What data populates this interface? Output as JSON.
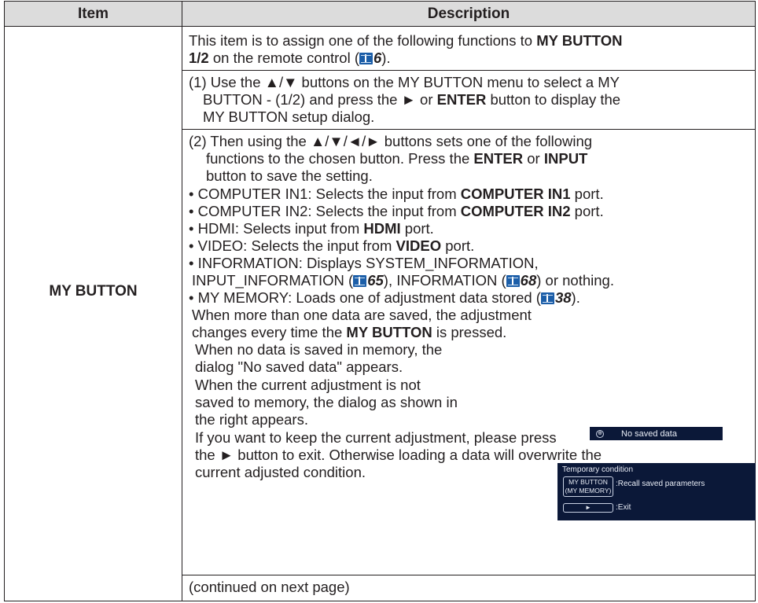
{
  "header": {
    "item": "Item",
    "description": "Description"
  },
  "row": {
    "item": "MY BUTTON",
    "intro": {
      "l1a": "This item is to assign one of the following functions to ",
      "l1b": "MY BUTTON",
      "l2a": "1/2",
      "l2b": " on the remote control (",
      "l2ref": "6",
      "l2c": ")."
    },
    "step1": {
      "l1": "(1) Use the ▲/▼ buttons on the MY BUTTON menu to select a MY",
      "l2a": "BUTTON - (1/2) and press the ► or ",
      "l2b": "ENTER",
      "l2c": " button to display the",
      "l3": "MY BUTTON setup dialog."
    },
    "step2": {
      "l1": "(2) Then using the ▲/▼/◄/► buttons sets one of the following",
      "l2a": "functions to the chosen button. Press the ",
      "l2b": "ENTER",
      "l2c": " or ",
      "l2d": "INPUT",
      "l3": "button to save the setting."
    },
    "bullets": {
      "comp1a": "• COMPUTER IN1: Selects the input from ",
      "comp1b": "COMPUTER IN1",
      "comp1c": " port.",
      "comp2a": "• COMPUTER IN2: Selects the input from ",
      "comp2b": "COMPUTER IN2",
      "comp2c": " port.",
      "hdmia": "• HDMI: Selects input from ",
      "hdmib": "HDMI",
      "hdmic": " port.",
      "videoa": "• VIDEO: Selects the input from ",
      "videob": "VIDEO",
      "videoc": " port.",
      "info1": "• INFORMATION: Displays SYSTEM_INFORMATION,",
      "info2a": "INPUT_INFORMATION (",
      "info2ref1": "65",
      "info2b": "), INFORMATION (",
      "info2ref2": "68",
      "info2c": ") or nothing.",
      "mem1a": "• MY MEMORY: Loads one of adjustment data stored (",
      "mem1ref": "38",
      "mem1b": ").",
      "mem2": "When more than one data are saved, the adjustment",
      "mem3a": "changes every time the ",
      "mem3b": "MY BUTTON",
      "mem3c": " is pressed.",
      "nosave1": "When no data is saved in memory, the",
      "nosave2": "dialog \"No saved data\" appears.",
      "cur1": "When the current adjustment is not",
      "cur2": "saved to memory, the dialog as shown in",
      "cur3": "the right appears.",
      "keep1": "If you want to keep the current adjustment, please press",
      "keep2": "the ► button to exit. Otherwise loading a data will overwrite the",
      "keep3": "current adjusted condition."
    },
    "continued": "(continued on next page)"
  },
  "dialog_no_saved": {
    "icon": "⊕",
    "text": "No saved data"
  },
  "dialog_temp": {
    "title": "Temporary condition",
    "button1_l1": "MY BUTTON",
    "button1_l2": "(MY MEMORY)",
    "label1": ":Recall saved parameters",
    "button2": "►",
    "label2": ":Exit"
  }
}
